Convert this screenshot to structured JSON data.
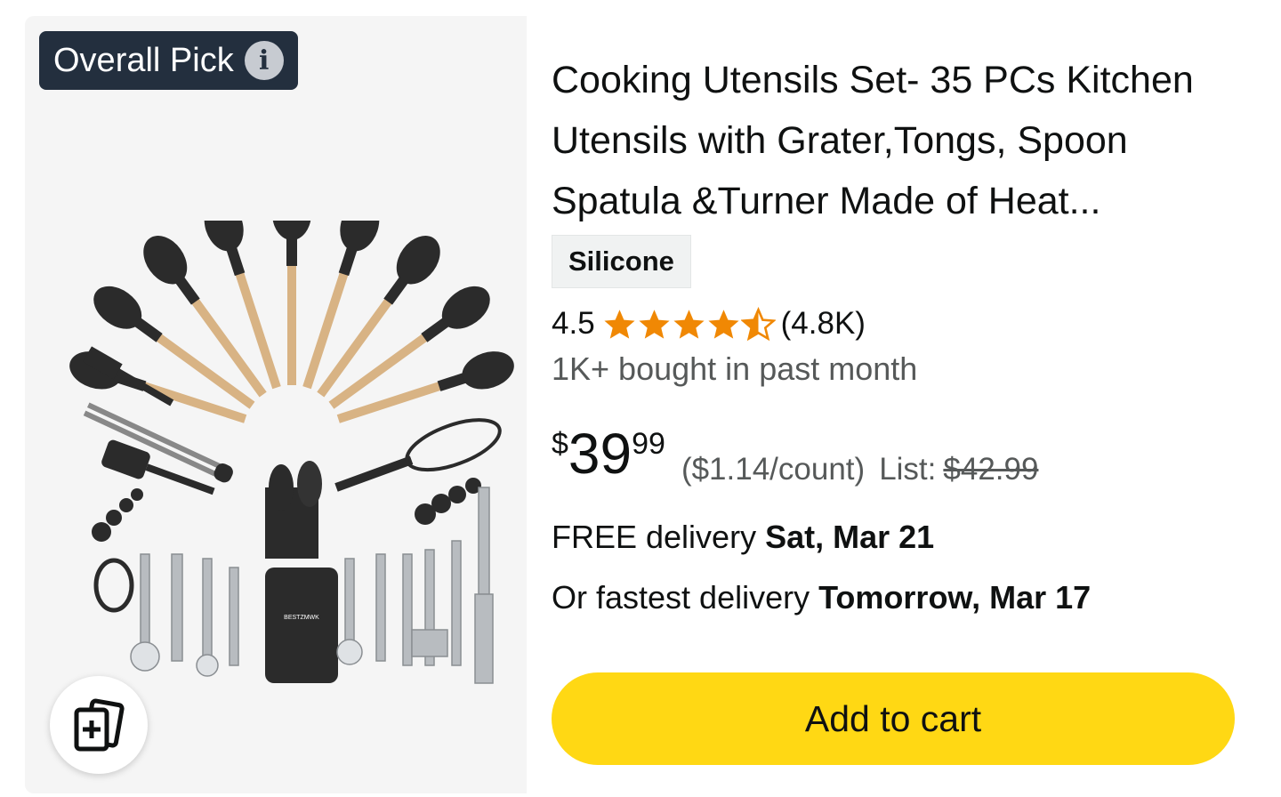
{
  "badge": {
    "label": "Overall Pick",
    "info_icon": "info-icon"
  },
  "product": {
    "title": "Cooking Utensils Set- 35 PCs Kitchen Utensils with Grater,Tongs, Spoon Spatula &Turner Made of Heat...",
    "tag": "Silicone",
    "image_brand": "BESTZMWK",
    "rating": {
      "value": "4.5",
      "stars": 4.5,
      "reviews": "(4.8K)"
    },
    "bought": "1K+ bought in past month",
    "price": {
      "symbol": "$",
      "whole": "39",
      "fraction": "99",
      "unit_price": "($1.14/count)",
      "list_label": "List:",
      "list_price": "$42.99"
    },
    "delivery": {
      "free_prefix": "FREE delivery",
      "free_date": "Sat, Mar 21",
      "fast_prefix": "Or fastest delivery",
      "fast_date": "Tomorrow, Mar 17"
    },
    "add_to_cart": "Add to cart"
  },
  "colors": {
    "badge_bg": "#232f3e",
    "star": "#f08804",
    "cart_button": "#ffd814",
    "image_bg": "#f5f5f5",
    "muted_text": "#565959"
  }
}
